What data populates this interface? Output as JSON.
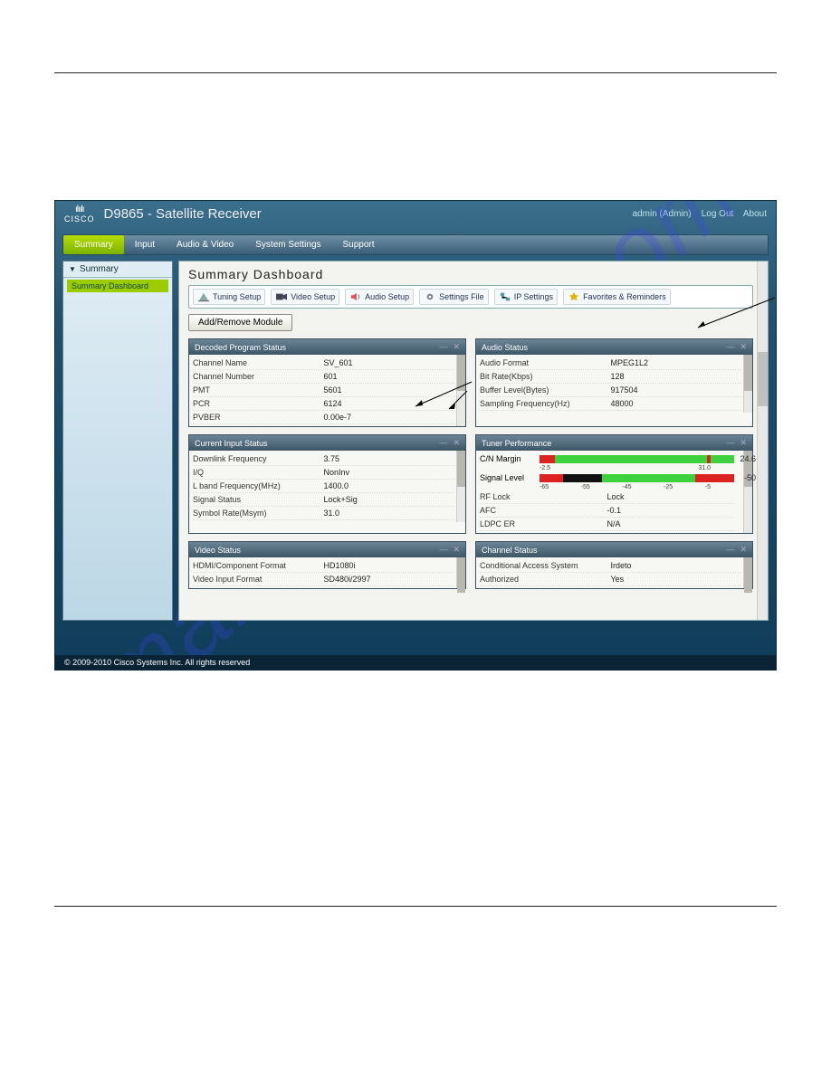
{
  "app_title": "D9865 - Satellite Receiver",
  "logo_text": "CISCO",
  "top_right": {
    "user": "admin (Admin)",
    "logout": "Log Out",
    "about": "About"
  },
  "tabs": [
    "Summary",
    "Input",
    "Audio & Video",
    "System Settings",
    "Support"
  ],
  "active_tab": 0,
  "sidebar": {
    "header": "Summary",
    "item": "Summary Dashboard"
  },
  "page_title": "Summary Dashboard",
  "shortcuts": [
    "Tuning Setup",
    "Video Setup",
    "Audio Setup",
    "Settings File",
    "IP Settings",
    "Favorites & Reminders"
  ],
  "add_remove_label": "Add/Remove Module",
  "modules": {
    "decoded": {
      "title": "Decoded Program Status",
      "rows": [
        {
          "k": "Channel Name",
          "v": "SV_601"
        },
        {
          "k": "Channel Number",
          "v": "601"
        },
        {
          "k": "PMT",
          "v": "5601"
        },
        {
          "k": "PCR",
          "v": "6124"
        },
        {
          "k": "PVBER",
          "v": "0.00e-7"
        }
      ]
    },
    "audio": {
      "title": "Audio Status",
      "rows": [
        {
          "k": "Audio Format",
          "v": "MPEG1L2"
        },
        {
          "k": "Bit Rate(Kbps)",
          "v": "128"
        },
        {
          "k": "Buffer Level(Bytes)",
          "v": "917504"
        },
        {
          "k": "Sampling Frequency(Hz)",
          "v": "48000"
        }
      ]
    },
    "input": {
      "title": "Current Input Status",
      "rows": [
        {
          "k": "Downlink Frequency",
          "v": "3.75"
        },
        {
          "k": "I/Q",
          "v": "NonInv"
        },
        {
          "k": "L band Frequency(MHz)",
          "v": "1400.0"
        },
        {
          "k": "Signal Status",
          "v": "Lock+Sig"
        },
        {
          "k": "Symbol Rate(Msym)",
          "v": "31.0"
        }
      ]
    },
    "tuner": {
      "title": "Tuner Performance",
      "cn_margin": {
        "label": "C/N Margin",
        "value": "24.6",
        "scale": [
          "-2.5",
          "",
          "",
          "",
          "31.0"
        ]
      },
      "signal_level": {
        "label": "Signal Level",
        "value": "-50",
        "scale": [
          "-65",
          "-55",
          "-45",
          "-25",
          "-5"
        ]
      },
      "rows": [
        {
          "k": "RF Lock",
          "v": "Lock"
        },
        {
          "k": "AFC",
          "v": "-0.1"
        },
        {
          "k": "LDPC ER",
          "v": "N/A"
        }
      ]
    },
    "video": {
      "title": "Video Status",
      "rows": [
        {
          "k": "HDMI/Component Format",
          "v": "HD1080i"
        },
        {
          "k": "Video Input Format",
          "v": "SD480i/2997"
        }
      ]
    },
    "channel": {
      "title": "Channel Status",
      "rows": [
        {
          "k": "Conditional Access System",
          "v": "Irdeto"
        },
        {
          "k": "Authorized",
          "v": "Yes"
        }
      ]
    }
  },
  "footer": "© 2009-2010 Cisco Systems Inc. All rights reserved",
  "watermark": "manualshive.com"
}
